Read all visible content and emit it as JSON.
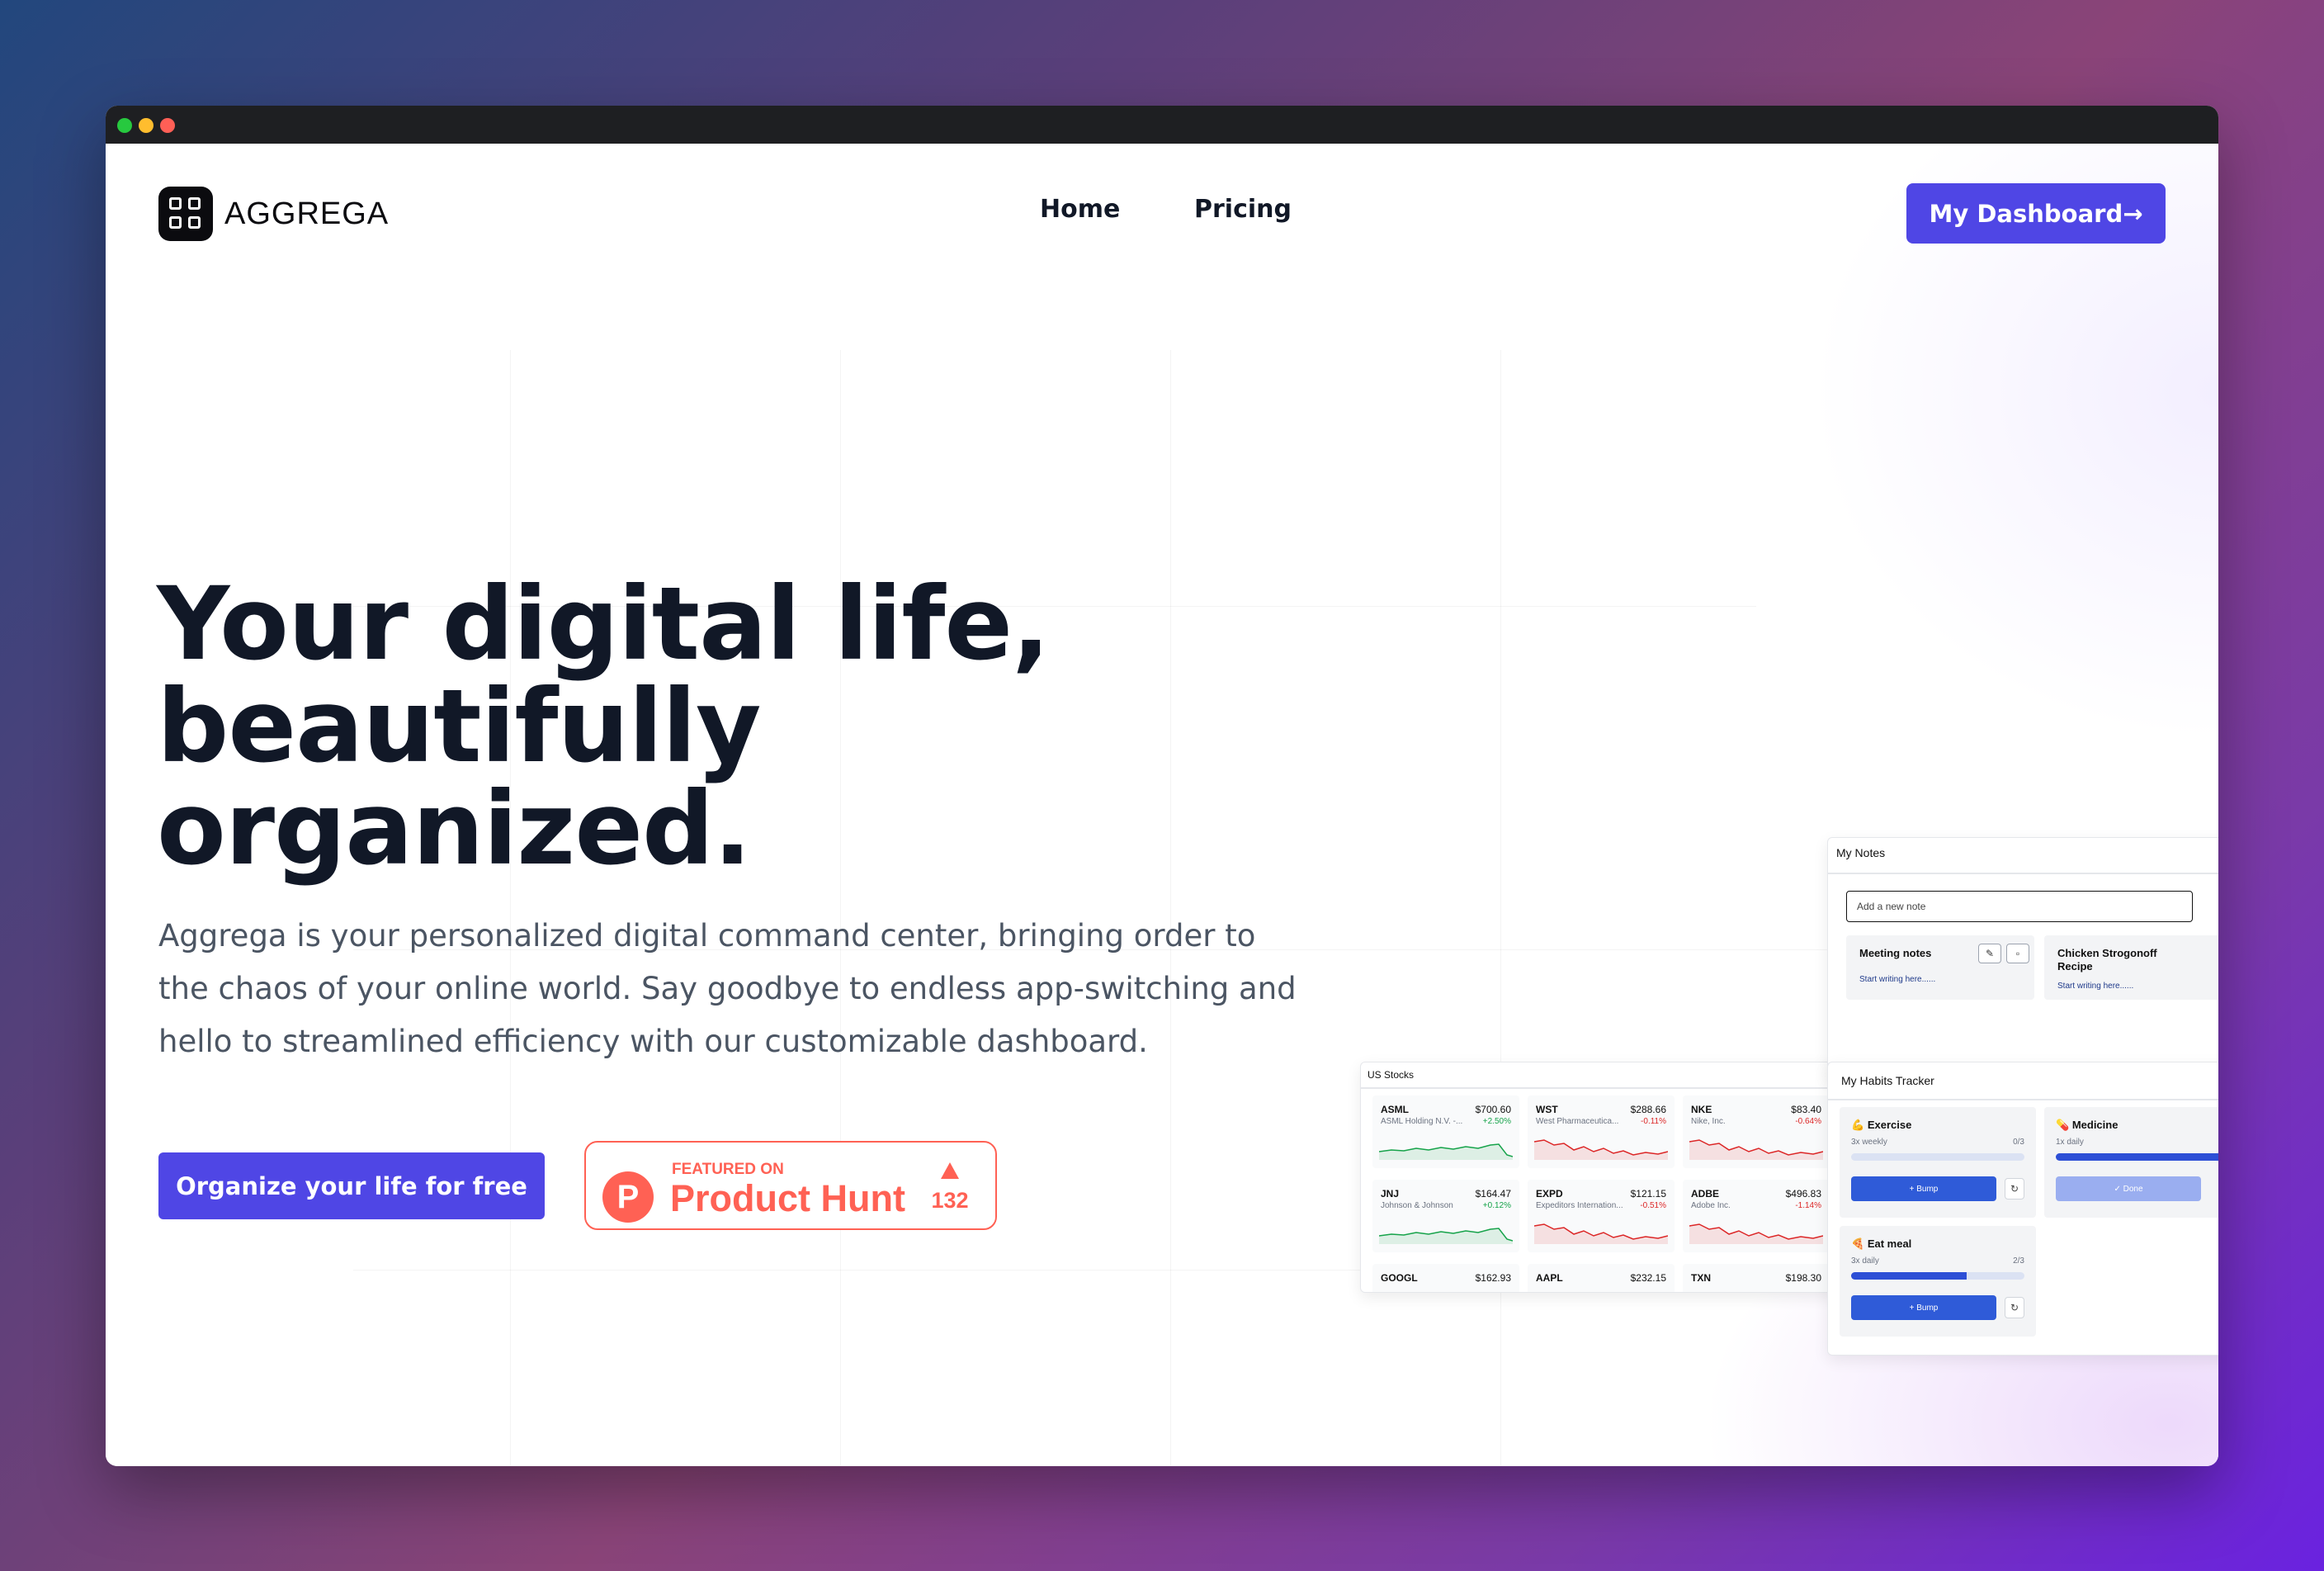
{
  "window": {
    "controls": [
      "close",
      "minimize",
      "maximize"
    ]
  },
  "brand": {
    "name": "AGGREGA",
    "logo_icon": "grid-logo-icon"
  },
  "nav": {
    "items": [
      "Home",
      "Pricing"
    ]
  },
  "header": {
    "dashboard_button": "My Dashboard→"
  },
  "hero": {
    "title_lines": [
      "Your digital life,",
      "beautifully",
      "organized."
    ],
    "description_lines": [
      "Aggrega is your personalized digital command center, bringing order to",
      "the chaos of your online world. Say goodbye to endless app-switching and",
      "hello to streamlined efficiency with our customizable dashboard."
    ],
    "cta_label": "Organize your life for free"
  },
  "product_hunt": {
    "kicker": "FEATURED ON",
    "name": "Product Hunt",
    "upvotes": "132",
    "logo_letter": "P"
  },
  "colors": {
    "accent": "#4f46e5",
    "product_hunt": "#ff6154",
    "positive": "#16a34a",
    "negative": "#dc2626"
  },
  "widgets": {
    "stocks": {
      "title": "US Stocks",
      "items": [
        {
          "symbol": "ASML",
          "price": "$700.60",
          "name": "ASML Holding N.V. -...",
          "change": "+2.50%",
          "trend": "up"
        },
        {
          "symbol": "WST",
          "price": "$288.66",
          "name": "West Pharmaceutica...",
          "change": "-0.11%",
          "trend": "down"
        },
        {
          "symbol": "NKE",
          "price": "$83.40",
          "name": "Nike, Inc.",
          "change": "-0.64%",
          "trend": "down"
        },
        {
          "symbol": "JNJ",
          "price": "$164.47",
          "name": "Johnson & Johnson",
          "change": "+0.12%",
          "trend": "up"
        },
        {
          "symbol": "EXPD",
          "price": "$121.15",
          "name": "Expeditors Internation...",
          "change": "-0.51%",
          "trend": "down"
        },
        {
          "symbol": "ADBE",
          "price": "$496.83",
          "name": "Adobe Inc.",
          "change": "-1.14%",
          "trend": "down"
        },
        {
          "symbol": "GOOGL",
          "price": "$162.93",
          "name": "",
          "change": "",
          "trend": "none"
        },
        {
          "symbol": "AAPL",
          "price": "$232.15",
          "name": "",
          "change": "",
          "trend": "none"
        },
        {
          "symbol": "TXN",
          "price": "$198.30",
          "name": "",
          "change": "",
          "trend": "none"
        }
      ]
    },
    "notes": {
      "title": "My Notes",
      "input_placeholder": "Add a new note",
      "cards": [
        {
          "title": "Meeting notes",
          "body": "Start writing here......"
        },
        {
          "title": "Chicken Strogonoff Recipe",
          "body": "Start writing here......"
        }
      ]
    },
    "habits": {
      "title": "My Habits Tracker",
      "items": [
        {
          "emoji": "💪",
          "name": "Exercise",
          "frequency": "3x weekly",
          "count": "0/3",
          "progress": 0,
          "button": "+ Bump"
        },
        {
          "emoji": "💊",
          "name": "Medicine",
          "frequency": "1x daily",
          "count": "",
          "progress": 1,
          "button": "✓ Done"
        },
        {
          "emoji": "🍕",
          "name": "Eat meal",
          "frequency": "3x daily",
          "count": "2/3",
          "progress": 0.667,
          "button": "+ Bump"
        }
      ]
    }
  }
}
